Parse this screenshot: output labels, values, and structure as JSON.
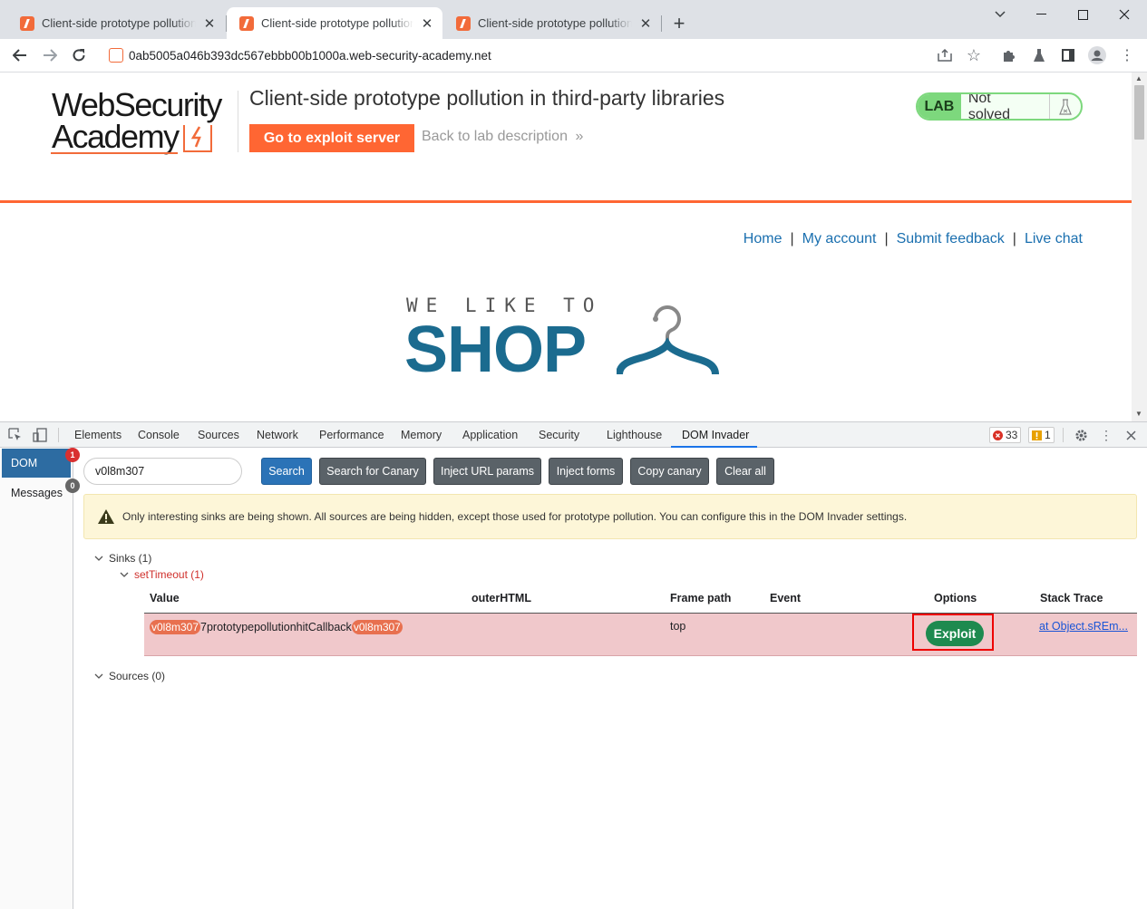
{
  "browser": {
    "tabs": [
      {
        "title": "Client-side prototype pollution in third-party libraries",
        "active": false
      },
      {
        "title": "Client-side prototype pollution in third-party libraries",
        "active": true
      },
      {
        "title": "Client-side prototype pollution in third-party libraries",
        "active": false
      }
    ],
    "url": "0ab5005a046b393dc567ebbb00b1000a.web-security-academy.net"
  },
  "header": {
    "logo_line1": "WebSecurity",
    "logo_line2": "Academy",
    "lab_title": "Client-side prototype pollution in third-party libraries",
    "exploit_server_label": "Go to exploit server",
    "back_link": "Back to lab description",
    "lab_badge": "LAB",
    "lab_status": "Not solved"
  },
  "site_nav": [
    "Home",
    "My account",
    "Submit feedback",
    "Live chat"
  ],
  "shop_logo": {
    "tagline": "WE LIKE TO",
    "word": "SHOP"
  },
  "devtools": {
    "tabs": [
      "Elements",
      "Console",
      "Sources",
      "Network",
      "Performance",
      "Memory",
      "Application",
      "Security",
      "Lighthouse",
      "DOM Invader"
    ],
    "active_tab": "DOM Invader",
    "error_count": "33",
    "warning_count": "1",
    "sidebar": [
      {
        "label": "DOM",
        "badge": "1"
      },
      {
        "label": "Messages",
        "badge": "0"
      }
    ],
    "canary_value": "v0l8m307",
    "buttons": {
      "search": "Search",
      "search_canary": "Search for Canary",
      "inject_url": "Inject URL params",
      "inject_forms": "Inject forms",
      "copy_canary": "Copy canary",
      "clear_all": "Clear all"
    },
    "warning_text": "Only interesting sinks are being shown. All sources are being hidden, except those used for prototype pollution. You can configure this in the DOM Invader settings.",
    "sinks_label": "Sinks (1)",
    "sink_name": "setTimeout (1)",
    "sources_label": "Sources (0)",
    "columns": [
      "Value",
      "outerHTML",
      "Frame path",
      "Event",
      "Options",
      "Stack Trace"
    ],
    "row": {
      "canary_prefix": "v0l8m307",
      "middle": "7prototypepollutionhitCallback",
      "canary_suffix": "v0l8m307",
      "frame_path": "top",
      "exploit_label": "Exploit",
      "stack_trace": "at Object.sREm..."
    }
  },
  "colors": {
    "accent": "#ff6633",
    "lab_green": "#7dd87d",
    "devtools_blue": "#2d6ca2",
    "exploit_green": "#1e8a4f"
  }
}
